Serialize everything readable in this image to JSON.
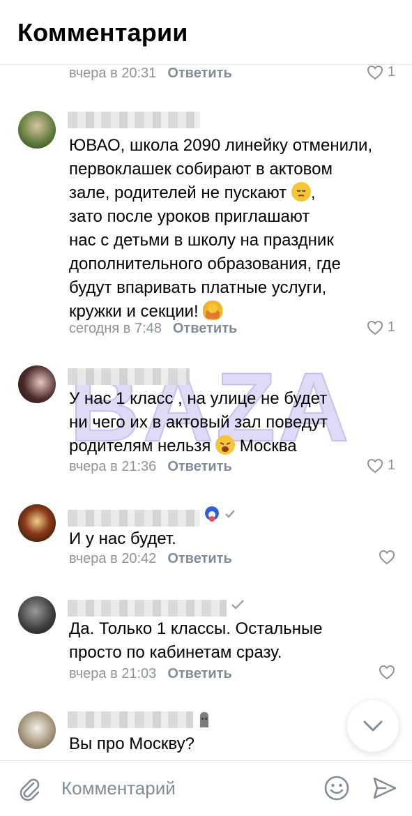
{
  "header": {
    "title": "Комментарии"
  },
  "comments": [
    {
      "date": "вчера в 20:31",
      "reply": "Ответить",
      "likes": "1"
    },
    {
      "text_lines": [
        "ЮВАО, школа 2090 линейку отменили,",
        "первоклашек собирают в актовом",
        "зале, родителей не пускают",
        "зато после уроков приглашают",
        "нас с детьми в школу на праздник",
        "дополнительного образования, где",
        "будут впаривать платные услуги,",
        "кружки и секции!"
      ],
      "date": "сегодня в 7:48",
      "reply": "Ответить",
      "likes": "1"
    },
    {
      "text_lines": [
        "У нас 1 класс , на улице не будет",
        "ни чего их в актовый зал поведут",
        "родителям нельзя",
        "Москва"
      ],
      "date": "вчера в 21:36",
      "reply": "Ответить",
      "likes": "1"
    },
    {
      "text_lines": [
        "И у нас будет."
      ],
      "date": "вчера в 20:42",
      "reply": "Ответить",
      "likes": ""
    },
    {
      "text_lines": [
        "Да. Только 1 классы. Остальные",
        "просто по кабинетам сразу."
      ],
      "date": "вчера в 21:03",
      "reply": "Ответить",
      "likes": ""
    },
    {
      "text_lines": [
        "Вы про Москву?"
      ]
    }
  ],
  "watermark": "BAZA",
  "composer": {
    "placeholder": "Комментарий"
  },
  "colors": {
    "meta": "#8e9299",
    "accent": "#818c99",
    "watermark": "#b8a9e6"
  },
  "icons": [
    "heart-icon",
    "attach-icon",
    "emoji-icon",
    "send-icon",
    "chevron-down-icon",
    "verified-icon"
  ]
}
